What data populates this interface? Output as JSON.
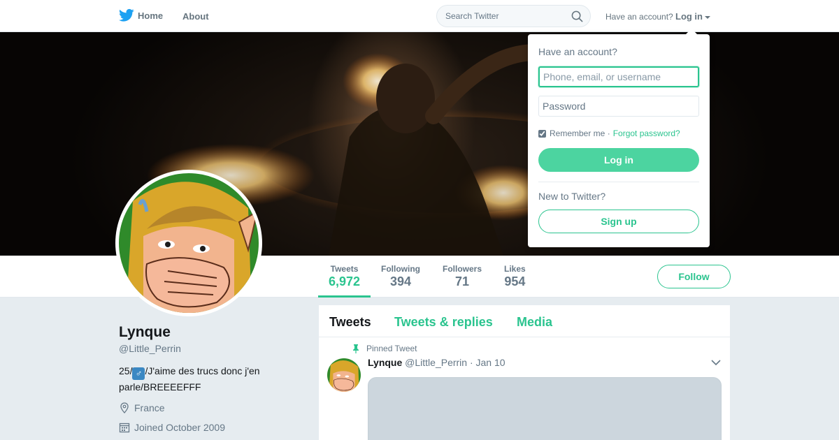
{
  "nav": {
    "home_label": "Home",
    "about_label": "About",
    "search_placeholder": "Search Twitter",
    "have_account": "Have an account?",
    "login_label": "Log in"
  },
  "profile": {
    "name": "Lynque",
    "handle": "@Little_Perrin",
    "bio_prefix": "25/",
    "bio_emoji": "♂",
    "bio_suffix": "/J'aime des trucs donc j'en parle/BREEEEFFF",
    "location": "France",
    "joined": "Joined October 2009",
    "follow_label": "Follow",
    "stats": [
      {
        "label": "Tweets",
        "value": "6,972"
      },
      {
        "label": "Following",
        "value": "394"
      },
      {
        "label": "Followers",
        "value": "71"
      },
      {
        "label": "Likes",
        "value": "954"
      }
    ]
  },
  "timeline": {
    "tabs": [
      "Tweets",
      "Tweets & replies",
      "Media"
    ],
    "pinned_label": "Pinned Tweet",
    "tweet": {
      "name": "Lynque",
      "handle": "@Little_Perrin",
      "date": "· Jan 10"
    }
  },
  "login_dropdown": {
    "title": "Have an account?",
    "username_placeholder": "Phone, email, or username",
    "password_placeholder": "Password",
    "remember_me": "Remember me ·",
    "remember_checked": true,
    "forgot_password": "Forgot password?",
    "login_button": "Log in",
    "new_to_twitter": "New to Twitter?",
    "signup_button": "Sign up"
  },
  "colors": {
    "accent": "#2bc48f",
    "login_button_bg": "#4cd4a0",
    "text_muted": "#657786"
  }
}
